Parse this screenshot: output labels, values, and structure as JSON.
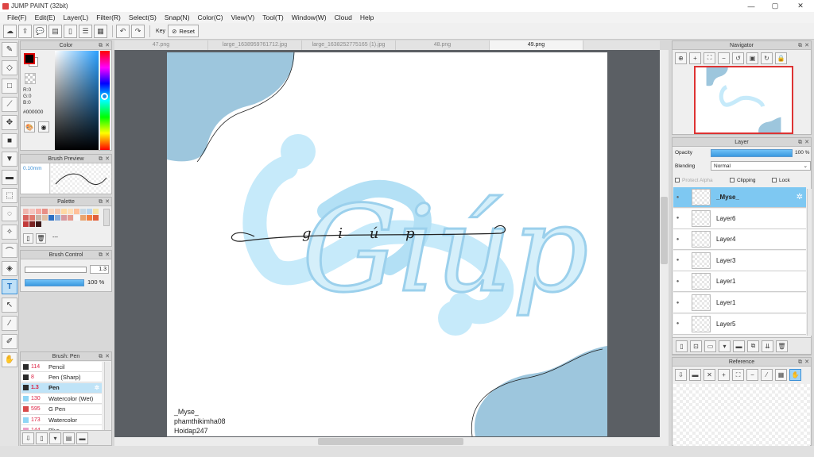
{
  "window": {
    "title": "JUMP PAINT (32bit)"
  },
  "menu": [
    "File(F)",
    "Edit(E)",
    "Layer(L)",
    "Filter(R)",
    "Select(S)",
    "Snap(N)",
    "Color(C)",
    "View(V)",
    "Tool(T)",
    "Window(W)",
    "Cloud",
    "Help"
  ],
  "toolbar": {
    "key_label": "Key",
    "reset_label": "Reset"
  },
  "color_panel": {
    "title": "Color",
    "r": "R:0",
    "g": "G:0",
    "b": "B:0",
    "hex": "#000000",
    "foreground": "#000000",
    "background": "#ffffff"
  },
  "brush_preview": {
    "title": "Brush Preview",
    "size": "0.10mm"
  },
  "palette": {
    "title": "Palette",
    "footer_text": "---",
    "swatches": [
      "#f0b7b0",
      "#f5c6c0",
      "#f6a9a0",
      "#e88f86",
      "#f8d7c2",
      "#f3c8b1",
      "#ffd9a3",
      "#ffdfb8",
      "#ffc09a",
      "#c9d9e4",
      "#b8d5ef",
      "#f4e2a6",
      "#d8635e",
      "#e17a6e",
      "#c7b5a8",
      "#e0bfa4",
      "#2d70c3",
      "#8aaedb",
      "#d89aa0",
      "#e69b8f",
      "#f7f7f7",
      "#e9a46f",
      "#f27f3f",
      "#e1603b",
      "#c23a3a",
      "#7a2222",
      "#3d1818"
    ]
  },
  "brush_control": {
    "title": "Brush Control",
    "size_value": "1.3",
    "opacity_value": "100 %"
  },
  "brush_list": {
    "title": "Brush: Pen",
    "items": [
      {
        "num": "114",
        "name": "Pencil",
        "color": "#2a2a2a"
      },
      {
        "num": "8",
        "name": "Pen (Sharp)",
        "color": "#2a2a2a"
      },
      {
        "num": "1.3",
        "name": "Pen",
        "color": "#2a2a2a",
        "selected": true
      },
      {
        "num": "130",
        "name": "Watercolor (Wet)",
        "color": "#8fd6f6"
      },
      {
        "num": "595",
        "name": "G Pen",
        "color": "#d84b4b"
      },
      {
        "num": "173",
        "name": "Watercolor",
        "color": "#8fd6f6"
      },
      {
        "num": "144",
        "name": "Blur",
        "color": "#e8a0c8"
      }
    ]
  },
  "tabs": [
    "47.png",
    "large_1638959761712.jpg",
    "large_1638252775165 (1).jpg",
    "48.png",
    "49.png"
  ],
  "canvas": {
    "credits": [
      "_Myse_",
      "phamthikimha08",
      "Hoidap247"
    ],
    "lettering_word": "Giúp",
    "small_word": "g  i  ú  p",
    "accent": "#a8d3e6",
    "letter_color": "#c6eafa"
  },
  "navigator": {
    "title": "Navigator"
  },
  "layer_panel": {
    "title": "Layer",
    "opacity_label": "Opacity",
    "opacity_value": "100 %",
    "blending_label": "Blending",
    "blending_value": "Normal",
    "protect_alpha": "Protect Alpha",
    "clipping": "Clipping",
    "lock": "Lock",
    "layers": [
      {
        "name": "_Myse_",
        "selected": true
      },
      {
        "name": "Layer6"
      },
      {
        "name": "Layer4"
      },
      {
        "name": "Layer3"
      },
      {
        "name": "Layer1"
      },
      {
        "name": "Layer1"
      },
      {
        "name": "Layer5"
      }
    ]
  },
  "reference": {
    "title": "Reference"
  }
}
